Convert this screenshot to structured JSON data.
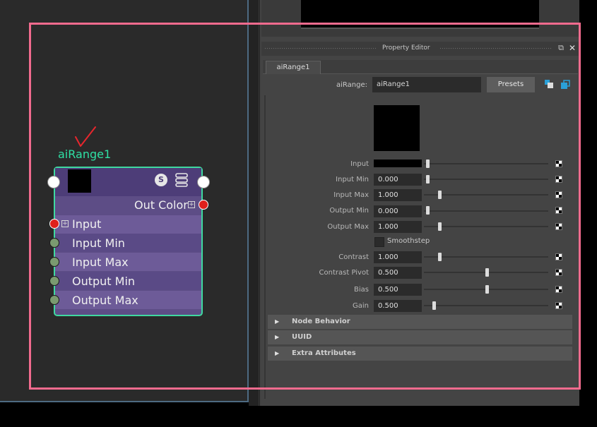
{
  "property_editor": {
    "title": "Property Editor",
    "tab": "aiRange1",
    "node_type_label": "aiRange:",
    "node_name_value": "aiRange1",
    "presets_button": "Presets"
  },
  "attributes": {
    "input_label": "Input",
    "input_min_label": "Input Min",
    "input_min_value": "0.000",
    "input_max_label": "Input Max",
    "input_max_value": "1.000",
    "output_min_label": "Output Min",
    "output_min_value": "0.000",
    "output_max_label": "Output Max",
    "output_max_value": "1.000",
    "smoothstep_label": "Smoothstep",
    "contrast_label": "Contrast",
    "contrast_value": "1.000",
    "contrast_pivot_label": "Contrast Pivot",
    "contrast_pivot_value": "0.500",
    "bias_label": "Bias",
    "bias_value": "0.500",
    "gain_label": "Gain",
    "gain_value": "0.500"
  },
  "frames": {
    "node_behavior": "Node Behavior",
    "uuid": "UUID",
    "extra_attributes": "Extra Attributes"
  },
  "node": {
    "name": "aiRange1",
    "out_color_label": "Out Color",
    "inputs": [
      "Input",
      "Input Min",
      "Input Max",
      "Output Min",
      "Output Max"
    ],
    "s_badge": "S"
  },
  "colors": {
    "node_border": "#3fd9a0",
    "node_body": "#5d4d86",
    "annotation": "#f26b8e",
    "port_red": "#e0201c",
    "port_green": "#7a9a70"
  }
}
